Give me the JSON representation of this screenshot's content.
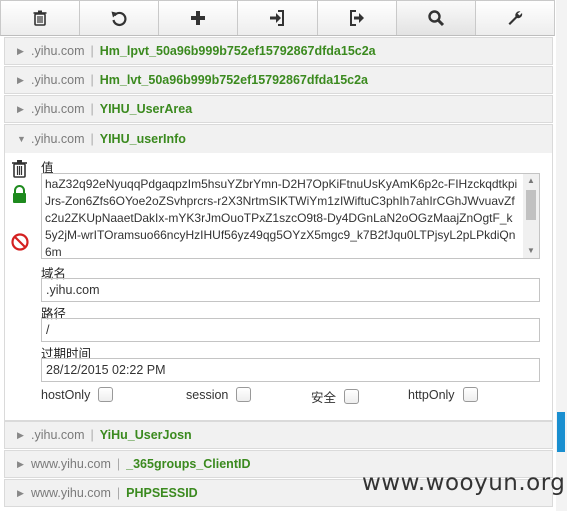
{
  "toolbar": {
    "buttons": [
      {
        "icon": "trash-icon"
      },
      {
        "icon": "undo-icon"
      },
      {
        "icon": "plus-icon"
      },
      {
        "icon": "import-icon"
      },
      {
        "icon": "export-icon"
      },
      {
        "icon": "search-icon"
      },
      {
        "icon": "wrench-icon"
      }
    ]
  },
  "colors": {
    "cookie_name": "#3b8a1f",
    "domain": "#7a7a7a",
    "accent": "#1a8fd0"
  },
  "cookies": [
    {
      "domain": ".yihu.com",
      "sep": "|",
      "name": "Hm_lpvt_50a96b999b752ef15792867dfda15c2a",
      "expanded": false
    },
    {
      "domain": ".yihu.com",
      "sep": "|",
      "name": "Hm_lvt_50a96b999b752ef15792867dfda15c2a",
      "expanded": false
    },
    {
      "domain": ".yihu.com",
      "sep": "|",
      "name": "YIHU_UserArea",
      "expanded": false
    },
    {
      "domain": ".yihu.com",
      "sep": "|",
      "name": "YIHU_userInfo",
      "expanded": true
    },
    {
      "domain": ".yihu.com",
      "sep": "|",
      "name": "YiHu_UserJosn",
      "expanded": false
    },
    {
      "domain": "www.yihu.com",
      "sep": "|",
      "name": "_365groups_ClientID",
      "expanded": false
    },
    {
      "domain": "www.yihu.com",
      "sep": "|",
      "name": "PHPSESSID",
      "expanded": false
    }
  ],
  "detail": {
    "value_label": "值",
    "value": "haZ32q92eNyuqqPdgaqpzIm5hsuYZbrYmn-D2H7OpKiFtnuUsKyAmK6p2c-FIHzckqdtkpiJrs-Zon6Zfs6OYoe2oZSvhprcrs-r2X3NrtmSIKTWiYm1zIWiftuC3phIh7ahIrCGhJWvuavZfc2u2ZKUpNaaetDakIx-mYK3rJmOuoTPxZ1szcO9t8-Dy4DGnLaN2oOGzMaajZnOgtF_k5y2jM-wrITOramsuo66ncyHzIHUf56yz49qg5OYzX5mgc9_k7B2fJqu0LTPjsyL2pLPkdiQn6m",
    "domain_label": "域名",
    "domain": ".yihu.com",
    "path_label": "路径",
    "path": "/",
    "expires_label": "过期时间",
    "expires": "28/12/2015 02:22 PM",
    "flags": [
      {
        "label": "hostOnly",
        "checked": false
      },
      {
        "label": "session",
        "checked": false
      },
      {
        "label": "安全",
        "checked": false
      },
      {
        "label": "httpOnly",
        "checked": false
      }
    ]
  },
  "watermark": "www.wooyun.org"
}
